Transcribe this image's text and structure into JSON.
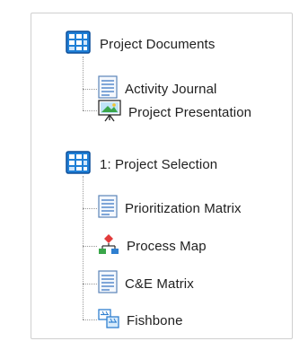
{
  "tree": {
    "groups": [
      {
        "label": "Project Documents",
        "icon": "project-folder-icon",
        "children": [
          {
            "label": "Activity Journal",
            "icon": "document-icon"
          },
          {
            "label": "Project Presentation",
            "icon": "presentation-icon"
          }
        ]
      },
      {
        "label": "1: Project Selection",
        "icon": "project-folder-icon",
        "children": [
          {
            "label": "Prioritization Matrix",
            "icon": "document-icon"
          },
          {
            "label": "Process Map",
            "icon": "process-map-icon"
          },
          {
            "label": "C&E Matrix",
            "icon": "document-icon"
          },
          {
            "label": "Fishbone",
            "icon": "fishbone-icon"
          }
        ]
      }
    ]
  },
  "colors": {
    "folder_blue": "#1f7fd6",
    "folder_dark": "#0d4f9a",
    "doc_border": "#5b84b8",
    "connector": "#9a9a9a"
  }
}
